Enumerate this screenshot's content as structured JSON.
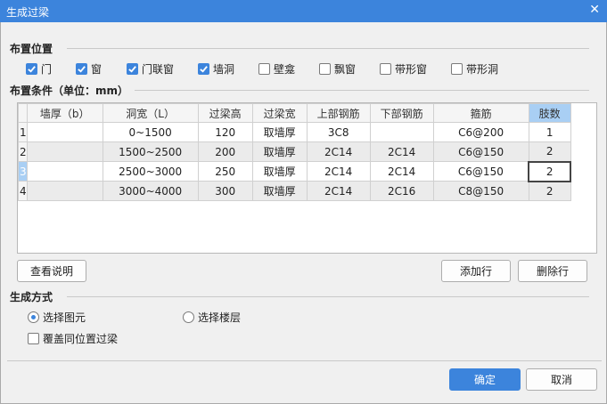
{
  "window": {
    "title": "生成过梁",
    "close_glyph": "✕"
  },
  "placement": {
    "label": "布置位置",
    "options": [
      {
        "label": "门",
        "checked": true
      },
      {
        "label": "窗",
        "checked": true
      },
      {
        "label": "门联窗",
        "checked": true
      },
      {
        "label": "墙洞",
        "checked": true
      },
      {
        "label": "壁龛",
        "checked": false
      },
      {
        "label": "飘窗",
        "checked": false
      },
      {
        "label": "带形窗",
        "checked": false
      },
      {
        "label": "带形洞",
        "checked": false
      }
    ]
  },
  "conditions": {
    "label": "布置条件（单位：mm）",
    "columns": [
      "墙厚（b）",
      "洞宽（L）",
      "过梁高",
      "过梁宽",
      "上部钢筋",
      "下部钢筋",
      "箍筋",
      "肢数"
    ],
    "rows": [
      {
        "num": "1",
        "cells": [
          "",
          "0~1500",
          "120",
          "取墙厚",
          "3C8",
          "",
          "C6@200",
          "1"
        ]
      },
      {
        "num": "2",
        "cells": [
          "",
          "1500~2500",
          "200",
          "取墙厚",
          "2C14",
          "2C14",
          "C6@150",
          "2"
        ]
      },
      {
        "num": "3",
        "cells": [
          "",
          "2500~3000",
          "250",
          "取墙厚",
          "2C14",
          "2C14",
          "C6@150",
          "2"
        ]
      },
      {
        "num": "4",
        "cells": [
          "",
          "3000~4000",
          "300",
          "取墙厚",
          "2C14",
          "2C16",
          "C8@150",
          "2"
        ]
      }
    ]
  },
  "buttons": {
    "view_help": "查看说明",
    "add_row": "添加行",
    "delete_row": "删除行",
    "ok": "确定",
    "cancel": "取消"
  },
  "generate": {
    "label": "生成方式",
    "radio_element": "选择图元",
    "radio_floor": "选择楼层",
    "overwrite": "覆盖同位置过梁",
    "selected": "element",
    "overwrite_checked": false
  },
  "colors": {
    "accent": "#3c84dc",
    "highlight": "#a9cff4"
  }
}
